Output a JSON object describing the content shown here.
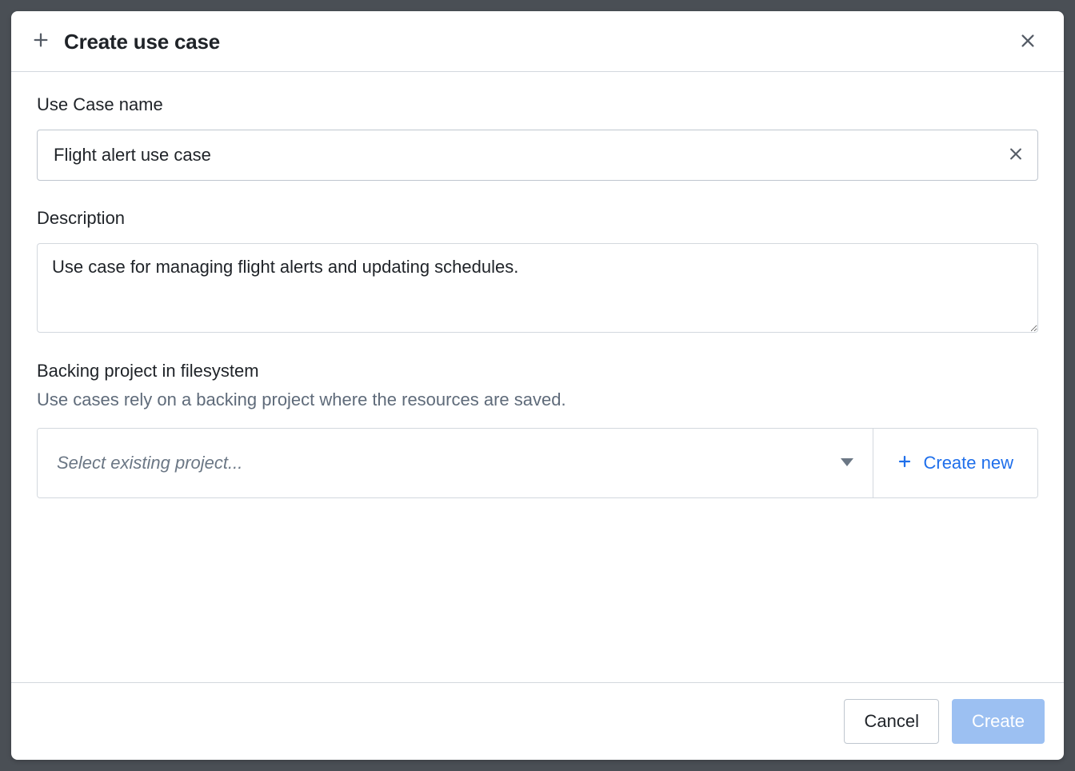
{
  "modal": {
    "title": "Create use case",
    "fields": {
      "name": {
        "label": "Use Case name",
        "value": "Flight alert use case"
      },
      "description": {
        "label": "Description",
        "value": "Use case for managing flight alerts and updating schedules."
      },
      "project": {
        "label": "Backing project in filesystem",
        "sublabel": "Use cases rely on a backing project where the resources are saved.",
        "placeholder": "Select existing project...",
        "create_new_label": "Create new"
      }
    },
    "footer": {
      "cancel_label": "Cancel",
      "create_label": "Create"
    }
  }
}
